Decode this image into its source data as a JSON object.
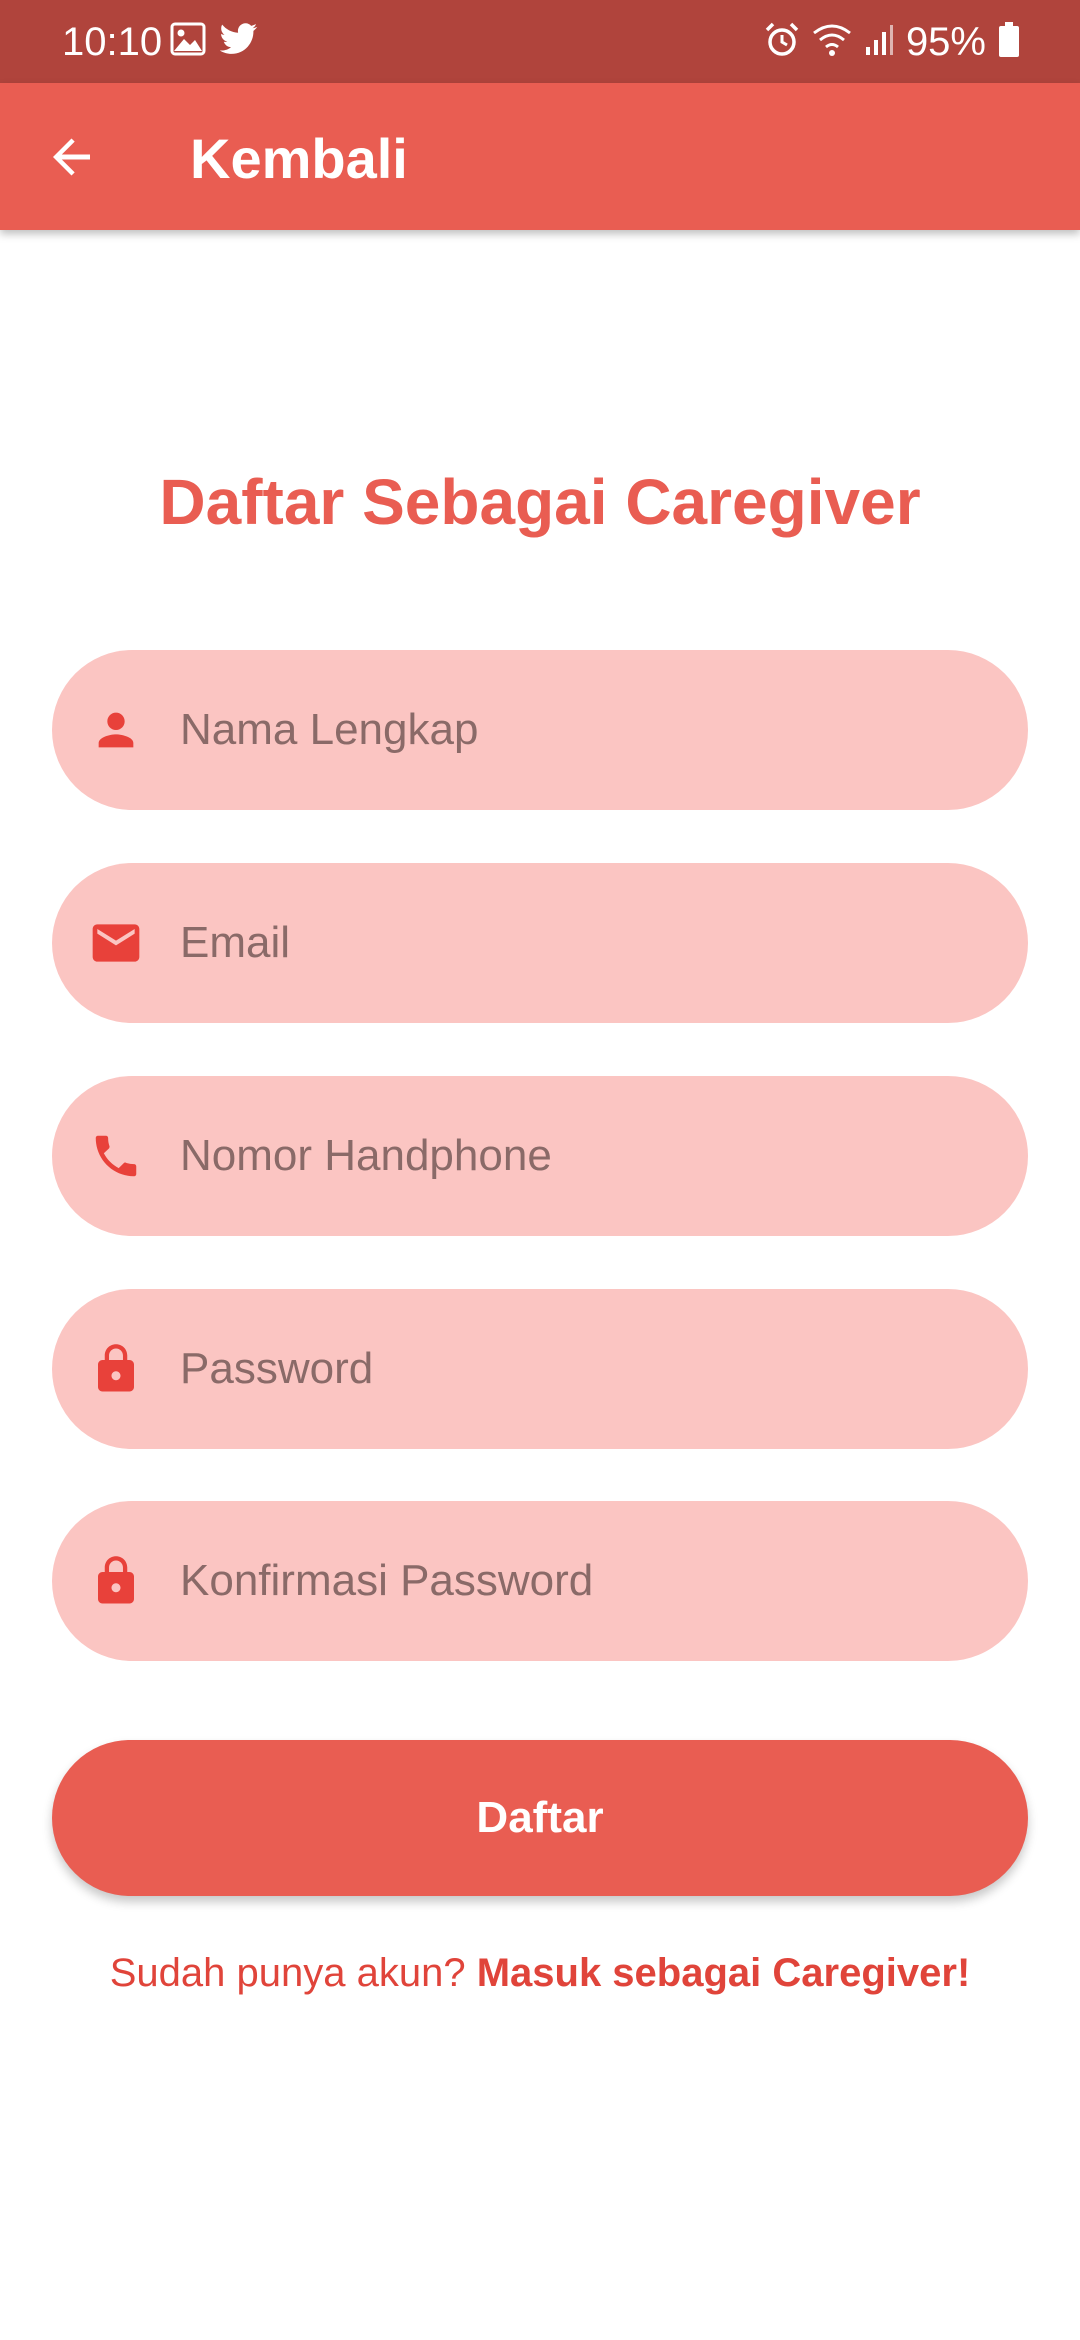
{
  "status_bar": {
    "time": "10:10",
    "battery": "95%",
    "icons": [
      "image-icon",
      "twitter-icon",
      "alarm-icon",
      "wifi-icon",
      "signal-icon",
      "battery-icon"
    ]
  },
  "app_bar": {
    "back_icon": "arrow-left-icon",
    "title": "Kembali"
  },
  "form": {
    "heading": "Daftar Sebagai Caregiver",
    "fields": [
      {
        "icon": "person-icon",
        "placeholder": "Nama Lengkap",
        "value": ""
      },
      {
        "icon": "mail-icon",
        "placeholder": "Email",
        "value": ""
      },
      {
        "icon": "phone-icon",
        "placeholder": "Nomor Handphone",
        "value": ""
      },
      {
        "icon": "lock-icon",
        "placeholder": "Password",
        "value": ""
      },
      {
        "icon": "lock-icon",
        "placeholder": "Konfirmasi Password",
        "value": ""
      }
    ],
    "submit_label": "Daftar",
    "login_prompt": "Sudah punya akun?",
    "login_link": "Masuk sebagai Caregiver!"
  },
  "colors": {
    "status_bar": "#b0443c",
    "primary": "#e95d52",
    "field_background": "#fbc5c2",
    "icon": "#e8413a",
    "link": "#e0443a",
    "background": "#ffffff"
  }
}
